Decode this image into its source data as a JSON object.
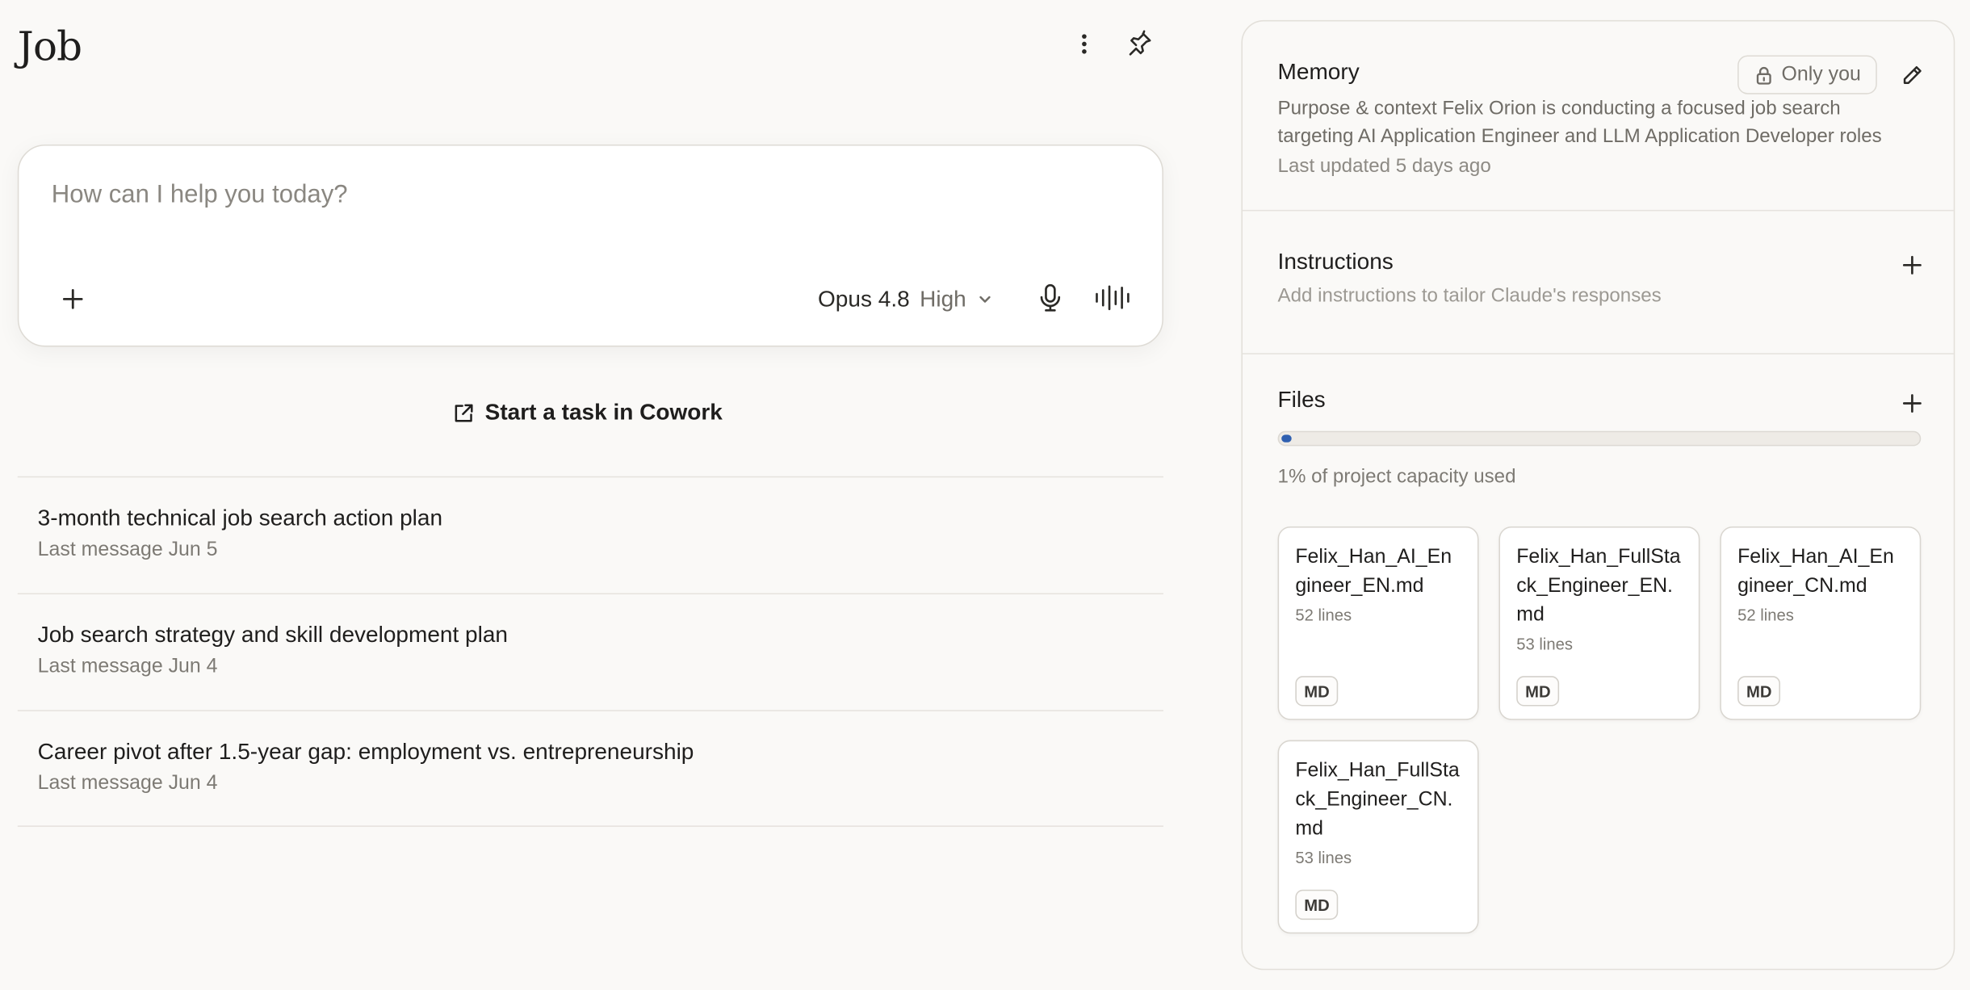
{
  "project": {
    "title": "Job"
  },
  "composer": {
    "placeholder": "How can I help you today?",
    "model": "Opus 4.8",
    "effort": "High"
  },
  "cowork": {
    "label": "Start a task in Cowork"
  },
  "chats": [
    {
      "title": "3-month technical job search action plan",
      "meta": "Last message Jun 5"
    },
    {
      "title": "Job search strategy and skill development plan",
      "meta": "Last message Jun 4"
    },
    {
      "title": "Career pivot after 1.5-year gap: employment vs. entrepreneurship",
      "meta": "Last message Jun 4"
    }
  ],
  "memory": {
    "heading": "Memory",
    "visibility": "Only you",
    "text": "Purpose & context Felix Orion is conducting a focused job search targeting AI Application Engineer and LLM Application Developer roles",
    "updated": "Last updated 5 days ago"
  },
  "instructions": {
    "heading": "Instructions",
    "hint": "Add instructions to tailor Claude's responses"
  },
  "files": {
    "heading": "Files",
    "capacity_fraction": 0.01,
    "capacity_label": "1% of project capacity used",
    "items": [
      {
        "name": "Felix_Han_AI_Engineer_EN.md",
        "lines": "52 lines",
        "tag": "MD"
      },
      {
        "name": "Felix_Han_FullStack_Engineer_EN.md",
        "lines": "53 lines",
        "tag": "MD"
      },
      {
        "name": "Felix_Han_AI_Engineer_CN.md",
        "lines": "52 lines",
        "tag": "MD"
      },
      {
        "name": "Felix_Han_FullStack_Engineer_CN.md",
        "lines": "53 lines",
        "tag": "MD"
      }
    ]
  },
  "icons": {
    "more": "more-vertical-icon",
    "pin": "pin-icon",
    "plus": "plus-icon",
    "chevron": "chevron-down-icon",
    "mic": "microphone-icon",
    "voice": "voice-waveform-icon",
    "external": "external-link-icon",
    "lock": "lock-icon",
    "edit": "pencil-icon"
  },
  "colors": {
    "accent": "#2f5fb0",
    "background": "#faf9f7"
  }
}
